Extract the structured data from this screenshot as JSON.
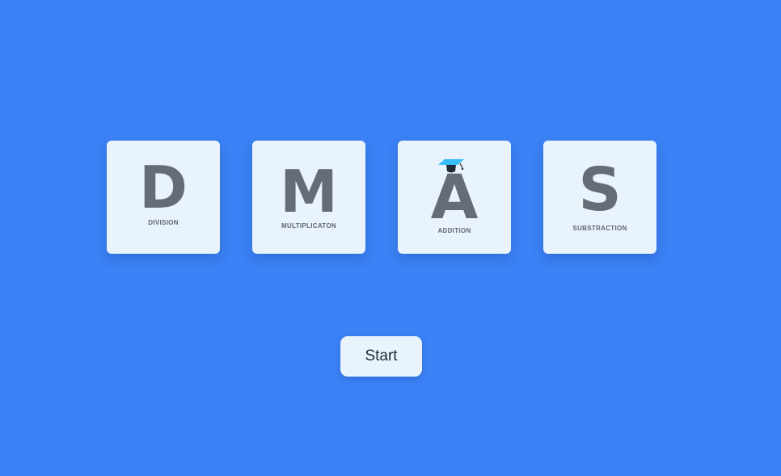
{
  "colors": {
    "background": "#3b82f6",
    "tile": "#e9f3fc",
    "letter": "#646c75",
    "cap_accent": "#38bdf8"
  },
  "tiles": [
    {
      "letter": "D",
      "label": "DIVISION"
    },
    {
      "letter": "M",
      "label": "MULTIPLICATON"
    },
    {
      "letter": "A",
      "label": "ADDITION",
      "icon": "graduation-cap-icon"
    },
    {
      "letter": "S",
      "label": "SUBSTRACTION"
    }
  ],
  "start_button": {
    "label": "Start"
  }
}
